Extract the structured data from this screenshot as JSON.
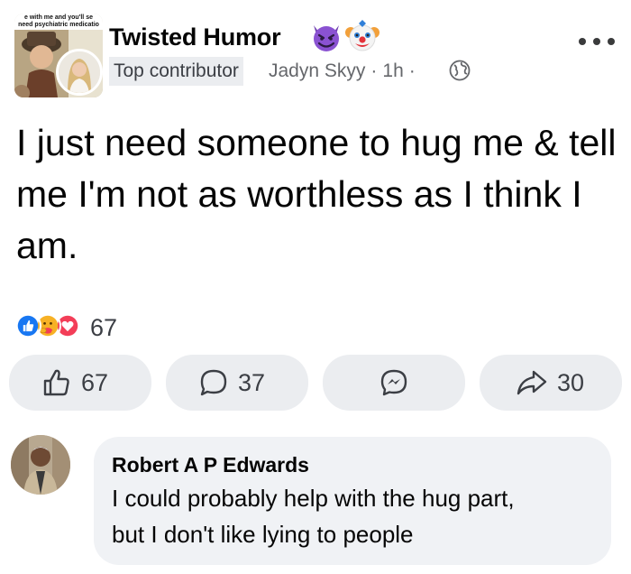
{
  "group_avatar_caption": "e with me and you'll se\nneed psychiatric medicatio",
  "post": {
    "group_name": "Twisted Humor",
    "badge": "Top contributor",
    "author": "Jadyn Skyy",
    "time": "1h",
    "separator": "·",
    "text": "I just need someone to hug me & tell me I'm not as worthless as I think I am.",
    "emojis": [
      "smiling-devil-icon",
      "clown-face-icon"
    ]
  },
  "reactions": {
    "icons": [
      "like-reaction-icon",
      "care-reaction-icon",
      "love-reaction-icon"
    ],
    "count": "67"
  },
  "actions": {
    "like_count": "67",
    "comment_count": "37",
    "share_count": "30"
  },
  "comment": {
    "author": "Robert A P Edwards",
    "line1": "I could probably help with the hug part,",
    "line2": "but I don't like lying to people"
  },
  "colors": {
    "like_blue": "#1877f2",
    "love_red": "#f33e58",
    "care_yellow": "#f7b125",
    "button_bg": "#ebedf0",
    "bubble_bg": "#f0f2f5",
    "meta_gray": "#65676b"
  }
}
